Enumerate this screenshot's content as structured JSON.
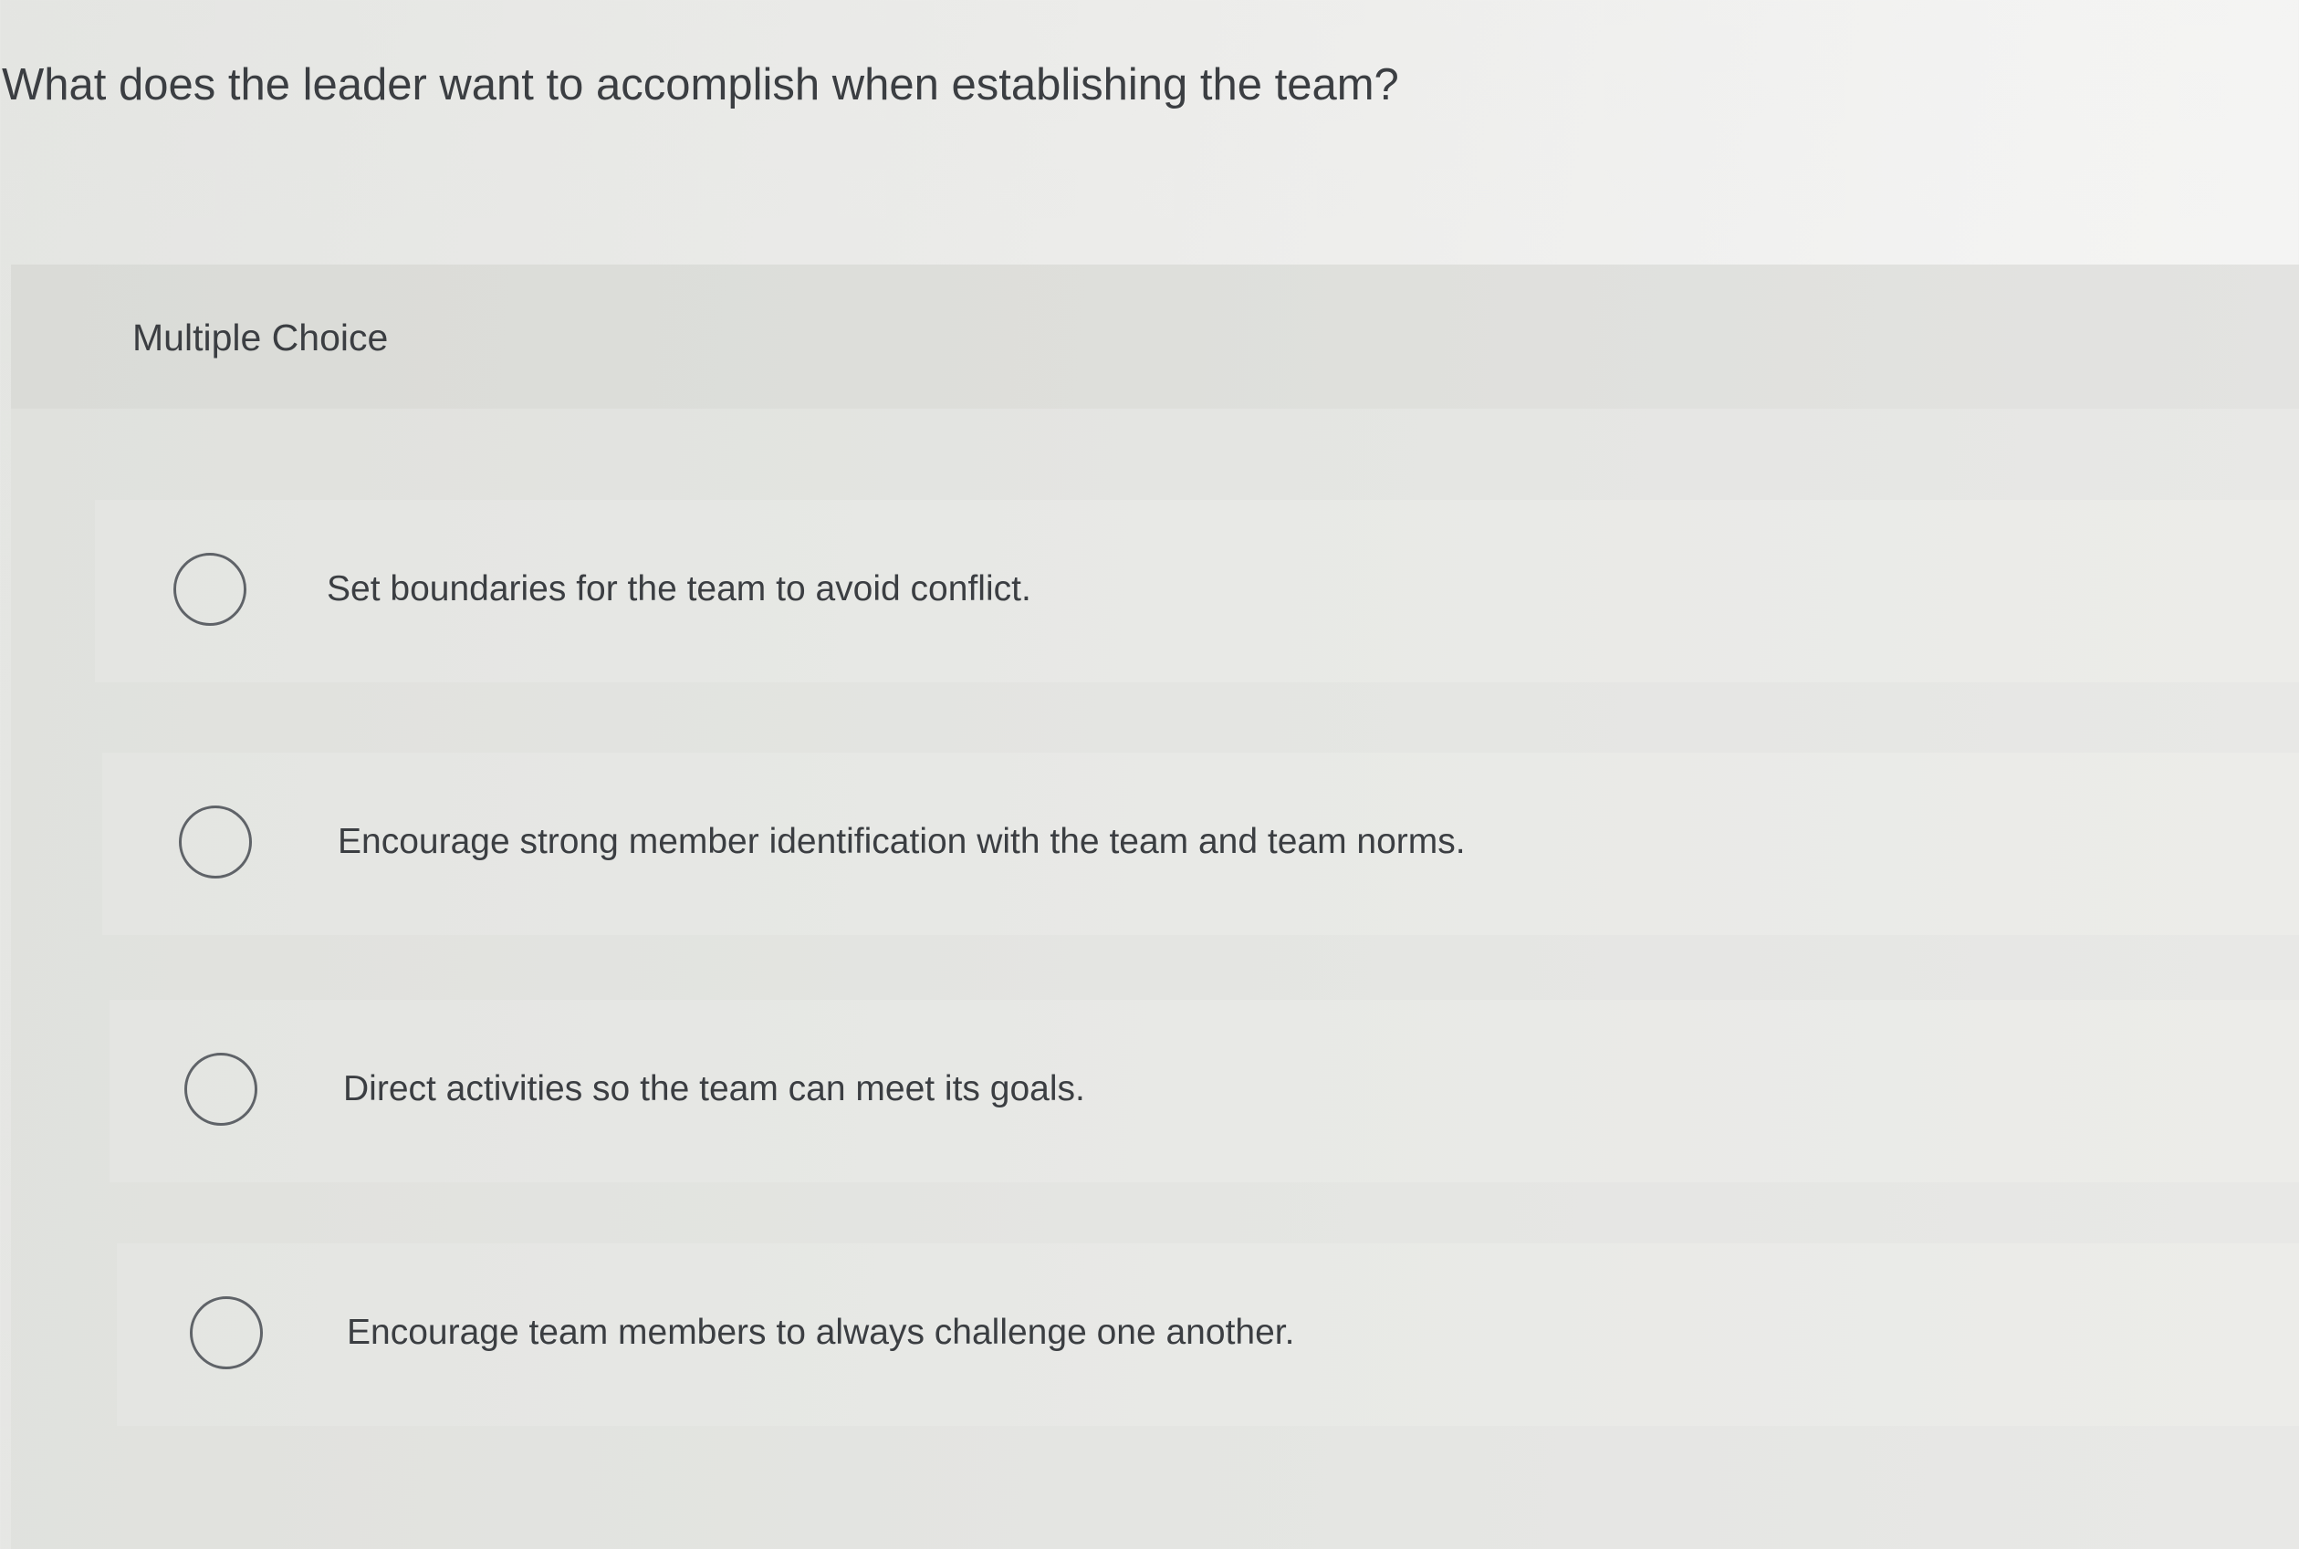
{
  "question": {
    "text": "What does the leader want to accomplish when establishing the team?"
  },
  "panel": {
    "type_label": "Multiple Choice"
  },
  "options": [
    {
      "label": "Set boundaries for the team to avoid conflict.",
      "selected": false
    },
    {
      "label": "Encourage strong member identification with the team and team norms.",
      "selected": false
    },
    {
      "label": "Direct activities so the team can meet its goals.",
      "selected": false
    },
    {
      "label": "Encourage team members to always challenge one another.",
      "selected": false
    }
  ],
  "colors": {
    "background": "#ececea",
    "panel": "#e4e5e2",
    "text": "#3b3e42",
    "radio_border": "#5f6368"
  }
}
